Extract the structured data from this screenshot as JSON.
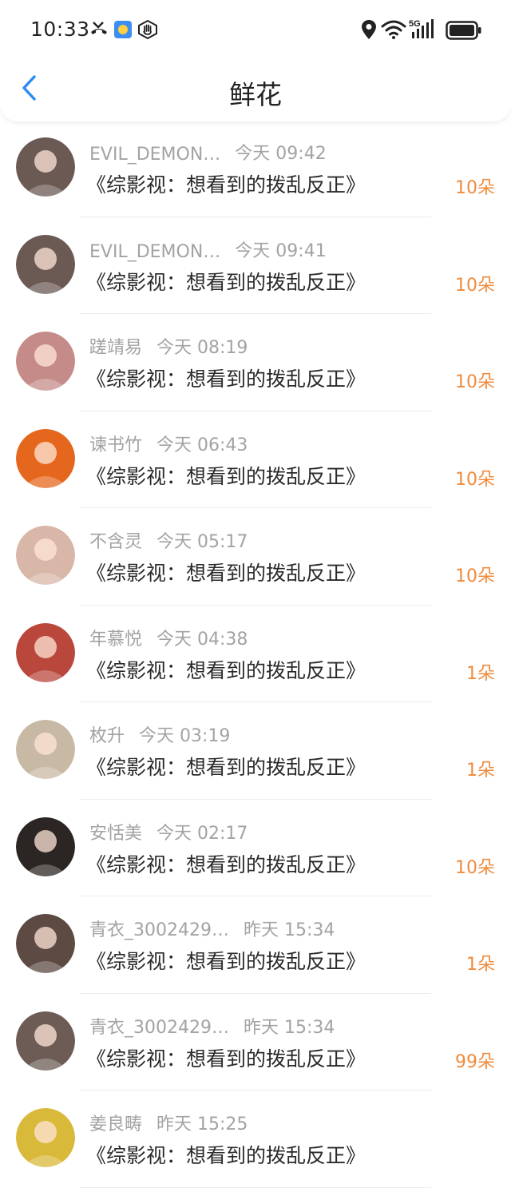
{
  "status": {
    "time": "10:33",
    "icons": [
      "missed-call-icon",
      "weather-icon",
      "hand-icon",
      "location-icon",
      "wifi-icon",
      "5g-signal-icon",
      "battery-icon"
    ],
    "network": "5G"
  },
  "header": {
    "title": "鲜花",
    "back_icon": "chevron-left-icon",
    "accent": "#2a8bf2"
  },
  "colors": {
    "count": "#ef8b3d",
    "meta": "#a3a3a3"
  },
  "items": [
    {
      "name": "EVIL_DEMON…",
      "time": "今天 09:42",
      "book": "《综影视：想看到的拨乱反正》",
      "count": "10朵",
      "avatar_color": "#6b5a54"
    },
    {
      "name": "EVIL_DEMON…",
      "time": "今天 09:41",
      "book": "《综影视：想看到的拨乱反正》",
      "count": "10朵",
      "avatar_color": "#6b5a54"
    },
    {
      "name": "蹉靖易",
      "time": "今天 08:19",
      "book": "《综影视：想看到的拨乱反正》",
      "count": "10朵",
      "avatar_color": "#c58b88"
    },
    {
      "name": "谏书竹",
      "time": "今天 06:43",
      "book": "《综影视：想看到的拨乱反正》",
      "count": "10朵",
      "avatar_color": "#e4671d"
    },
    {
      "name": "不含灵",
      "time": "今天 05:17",
      "book": "《综影视：想看到的拨乱反正》",
      "count": "10朵",
      "avatar_color": "#d9b7a8"
    },
    {
      "name": "年慕悦",
      "time": "今天 04:38",
      "book": "《综影视：想看到的拨乱反正》",
      "count": "1朵",
      "avatar_color": "#b9473c"
    },
    {
      "name": "枚升",
      "time": "今天 03:19",
      "book": "《综影视：想看到的拨乱反正》",
      "count": "1朵",
      "avatar_color": "#c8b9a4"
    },
    {
      "name": "安恬美",
      "time": "今天 02:17",
      "book": "《综影视：想看到的拨乱反正》",
      "count": "10朵",
      "avatar_color": "#2b2623"
    },
    {
      "name": "青衣_3002429…",
      "time": "昨天 15:34",
      "book": "《综影视：想看到的拨乱反正》",
      "count": "1朵",
      "avatar_color": "#5c4a43"
    },
    {
      "name": "青衣_3002429…",
      "time": "昨天 15:34",
      "book": "《综影视：想看到的拨乱反正》",
      "count": "99朵",
      "avatar_color": "#6c5c55"
    },
    {
      "name": "姜良畴",
      "time": "昨天 15:25",
      "book": "《综影视：想看到的拨乱反正》",
      "count": "",
      "avatar_color": "#d9b93a"
    }
  ]
}
